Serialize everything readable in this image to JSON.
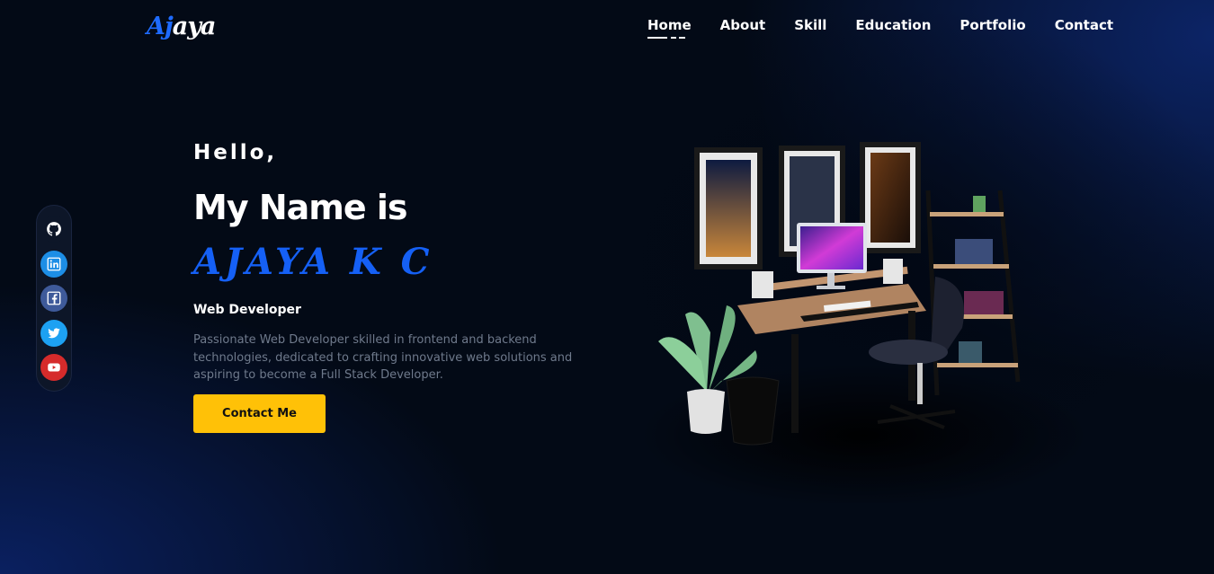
{
  "header": {
    "logo_part1": "Aj",
    "logo_part2": "aya",
    "nav": [
      {
        "label": "Home",
        "active": true
      },
      {
        "label": "About",
        "active": false
      },
      {
        "label": "Skill",
        "active": false
      },
      {
        "label": "Education",
        "active": false
      },
      {
        "label": "Portfolio",
        "active": false
      },
      {
        "label": "Contact",
        "active": false
      }
    ]
  },
  "social": [
    {
      "icon": "github-icon"
    },
    {
      "icon": "linkedin-icon"
    },
    {
      "icon": "facebook-icon"
    },
    {
      "icon": "twitter-icon"
    },
    {
      "icon": "youtube-icon"
    }
  ],
  "hero": {
    "greeting": "Hello,",
    "intro": "My Name is",
    "name": "AJAYA K C",
    "role": "Web Developer",
    "description": "Passionate Web Developer skilled in frontend and backend technologies, dedicated to crafting innovative web solutions and aspiring to become a Full Stack Developer.",
    "cta_label": "Contact Me"
  },
  "colors": {
    "accent_blue": "#1560f5",
    "cta_yellow": "#ffc107",
    "background": "#030a16"
  }
}
